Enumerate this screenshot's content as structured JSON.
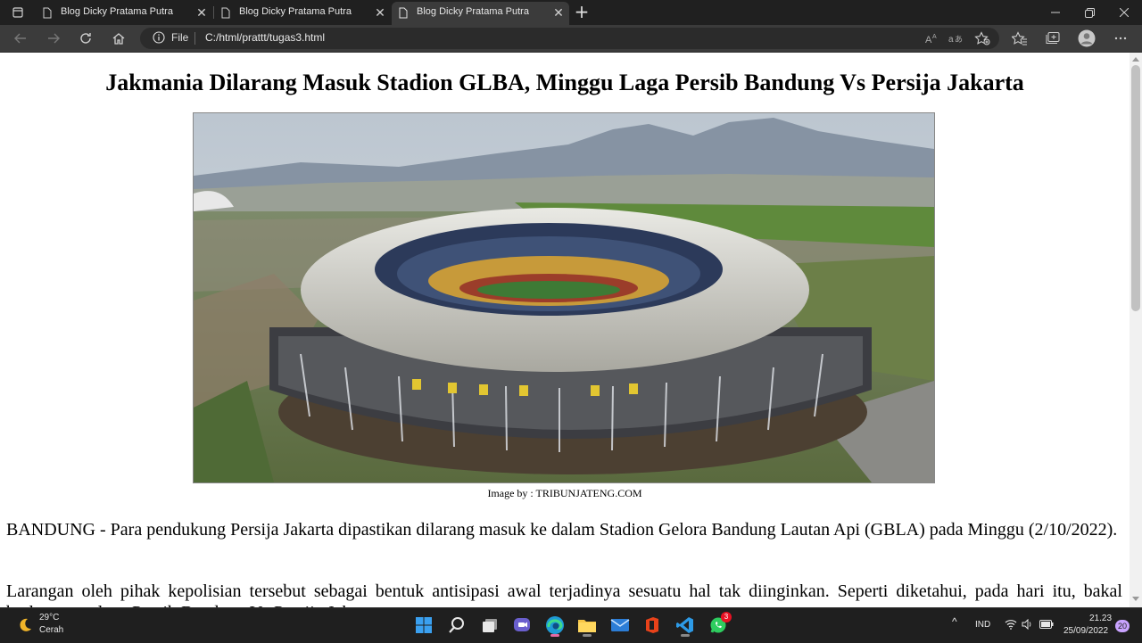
{
  "browser": {
    "tabs": [
      {
        "title": "Blog Dicky Pratama Putra",
        "active": false
      },
      {
        "title": "Blog Dicky Pratama Putra",
        "active": false
      },
      {
        "title": "Blog Dicky Pratama Putra",
        "active": true
      }
    ],
    "address": {
      "scheme_label": "File",
      "url": "C:/html/prattt/tugas3.html"
    },
    "read_aloud_icon": "Aᵀ",
    "translate_icon": "a̶"
  },
  "article": {
    "headline": "Jakmania Dilarang Masuk Stadion GLBA, Minggu Laga Persib Bandung Vs Persija Jakarta",
    "image_caption": "Image by : TRIBUNJATENG.COM",
    "paragraphs": [
      "BANDUNG - Para pendukung Persija Jakarta dipastikan dilarang masuk ke dalam Stadion Gelora Bandung Lautan Api (GBLA) pada Minggu (2/10/2022).",
      "Larangan oleh pihak kepolisian tersebut sebagai bentuk antisipasi awal terjadinya sesuatu hal tak diinginkan. Seperti diketahui, pada hari itu, bakal berlangsung laga Persib Bandung Vs Persija Jakarta."
    ]
  },
  "taskbar": {
    "weather": {
      "temp": "29°C",
      "desc": "Cerah"
    },
    "apps": [
      "start-icon",
      "search-icon",
      "task-view-icon",
      "teams-chat-icon",
      "edge-icon",
      "file-explorer-icon",
      "mail-icon",
      "office-icon",
      "vscode-icon",
      "whatsapp-icon"
    ],
    "whatsapp_badge": "3",
    "tray": {
      "lang": "IND",
      "time": "21.23",
      "date": "25/09/2022",
      "notifications": "20"
    }
  }
}
